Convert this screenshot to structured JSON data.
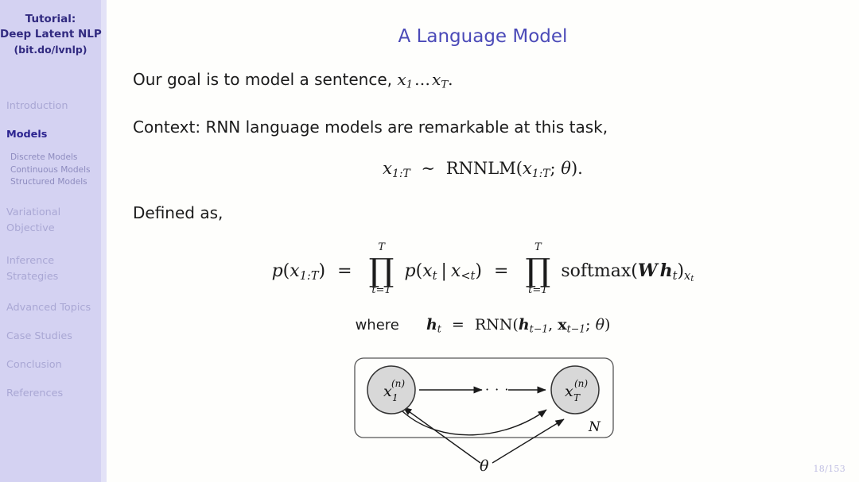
{
  "sidebar": {
    "title_lines": [
      "Tutorial:",
      "Deep Latent NLP",
      "(bit.do/lvnlp)"
    ],
    "sections": [
      {
        "label": "Introduction",
        "active": false,
        "subs": []
      },
      {
        "label": "Models",
        "active": true,
        "subs": [
          "Discrete Models",
          "Continuous Models",
          "Structured Models"
        ]
      },
      {
        "label": "Variational Objective",
        "active": false,
        "subs": []
      },
      {
        "label": "Inference Strategies",
        "active": false,
        "subs": []
      },
      {
        "label": "Advanced Topics",
        "active": false,
        "subs": []
      },
      {
        "label": "Case Studies",
        "active": false,
        "subs": []
      },
      {
        "label": "Conclusion",
        "active": false,
        "subs": []
      },
      {
        "label": "References",
        "active": false,
        "subs": []
      }
    ],
    "colors": {
      "background": "#d4d2f2",
      "edge": "#e3e2f7",
      "active_text": "#2b2390",
      "inactive_text": "#a9a7d4",
      "sub_text": "#8e8cbf",
      "title_text": "#312a80"
    }
  },
  "page_number": "18/153",
  "slide": {
    "title": "A Language Model",
    "title_color": "#4b4ab8",
    "line_goal_prefix": "Our goal is to model a sentence,",
    "line_context": "Context: RNN language models are remarkable at this task,",
    "line_defined": "Defined as,",
    "where_word": "where",
    "equation_distribution_text": "x_{1:T} ~ RNNLM(x_{1:T}; θ).",
    "equation_main_text": "p(x_{1:T}) = ∏_{t=1}^{T} p(x_t | x_{<t}) = ∏_{t=1}^{T} softmax(W h_t)_{x_t}",
    "equation_where_text": "h_t = RNN(h_{t-1}, x_{t-1}; θ)",
    "symbols": {
      "x": "x",
      "p": "p",
      "T": "T",
      "t": "t",
      "theta": "θ",
      "sim": "∼",
      "prod": "∏",
      "eq": "=",
      "mid": "|",
      "lt": "<",
      "rnnlm": "RNNLM",
      "rnn": "RNN",
      "softmax": "softmax",
      "W": "W",
      "h": "h",
      "ellipsis": "…",
      "range": "1:T",
      "one": "1",
      "tminus1": "t−1",
      "t1": "t=1"
    }
  },
  "diagram": {
    "node_left": {
      "base": "x",
      "sub": "1",
      "sup": "(n)"
    },
    "node_right": {
      "base": "x",
      "sub": "T",
      "sup": "(n)"
    },
    "dots": "· · ·",
    "plate_label": "N",
    "param_label": "θ",
    "node_fill": "#d8d8d8",
    "node_stroke": "#333333",
    "plate_stroke": "#555555"
  }
}
